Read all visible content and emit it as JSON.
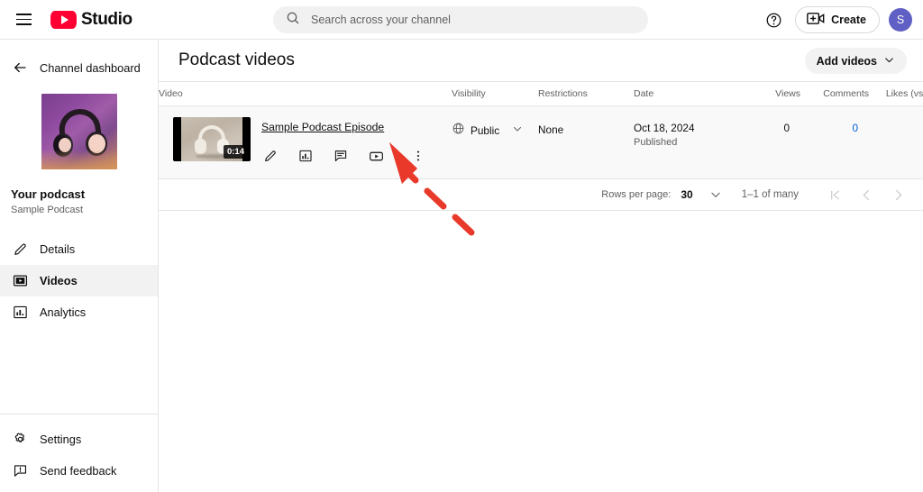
{
  "topbar": {
    "menu_icon": "hamburger-icon",
    "brand": "Studio",
    "logo_icon": "youtube-logo-icon",
    "help_icon": "help-circle-icon",
    "create_label": "Create",
    "create_icon": "video-plus-icon",
    "avatar_initial": "S",
    "avatar_color": "#5f5fc4"
  },
  "search": {
    "placeholder": "Search across your channel",
    "value": "",
    "icon": "search-icon"
  },
  "sidebar": {
    "dashboard_label": "Channel dashboard",
    "back_icon": "arrow-left-icon",
    "channel_name": "Your podcast",
    "channel_subtitle": "Sample Podcast",
    "thumbnail_icon": "headphones-thumbnail",
    "items": [
      {
        "label": "Details",
        "icon": "pencil-icon",
        "active": false
      },
      {
        "label": "Videos",
        "icon": "video-icon",
        "active": true
      },
      {
        "label": "Analytics",
        "icon": "bar-chart-icon",
        "active": false
      }
    ],
    "bottom_items": [
      {
        "label": "Settings",
        "icon": "gear-icon"
      },
      {
        "label": "Send feedback",
        "icon": "feedback-icon"
      }
    ]
  },
  "main": {
    "page_title": "Podcast videos",
    "add_videos_label": "Add videos",
    "add_videos_chevron": "chevron-down-icon",
    "table": {
      "columns": [
        "Video",
        "Visibility",
        "Restrictions",
        "Date",
        "Views",
        "Comments",
        "Likes (vs. dislikes)"
      ],
      "rows": [
        {
          "title": "Sample Podcast Episode",
          "duration": "0:14",
          "thumbnail_icon": "headphones-video-thumbnail",
          "visibility": "Public",
          "visibility_icon": "globe-icon",
          "visibility_chevron": "chevron-down-icon",
          "restrictions": "None",
          "date": "Oct 18, 2024",
          "date_status": "Published",
          "views": "0",
          "comments": "0",
          "comments_color": "#065fd4",
          "likes": "–",
          "actions": [
            {
              "name": "edit-details-button",
              "icon": "pencil-icon"
            },
            {
              "name": "analytics-button",
              "icon": "bar-chart-box-icon"
            },
            {
              "name": "comments-button",
              "icon": "comment-box-icon"
            },
            {
              "name": "watch-on-youtube-button",
              "icon": "youtube-play-box-icon"
            },
            {
              "name": "more-options-button",
              "icon": "three-dots-vertical-icon"
            }
          ]
        }
      ]
    },
    "pagination": {
      "rows_per_page_label": "Rows per page:",
      "rows_per_page_value": "30",
      "rows_per_page_chevron": "chevron-down-icon",
      "range_label": "1–1 of many",
      "first_icon": "page-first-icon",
      "prev_icon": "chevron-left-icon",
      "next_icon": "chevron-right-icon"
    }
  },
  "annotation": {
    "type": "dashed-arrow",
    "color": "#e8392b",
    "points_to": "more-options-button"
  }
}
